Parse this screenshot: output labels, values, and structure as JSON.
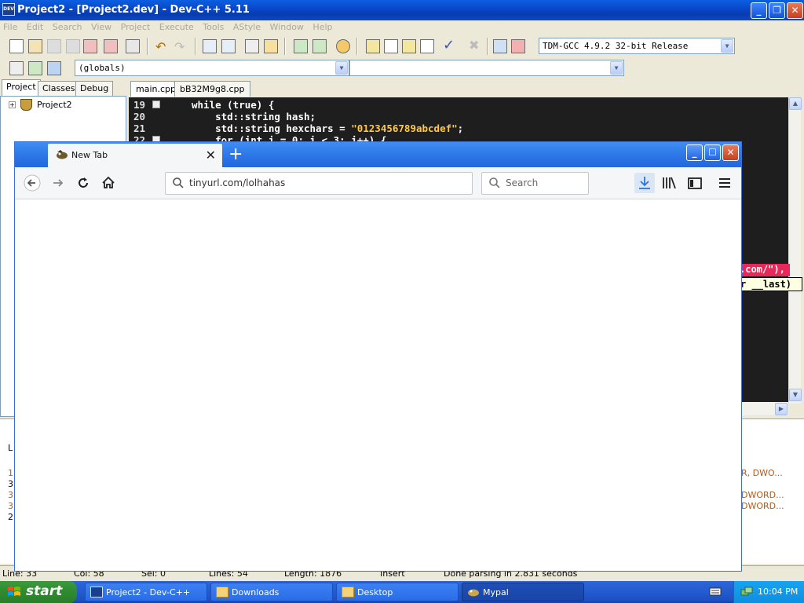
{
  "devcpp": {
    "title": "Project2 - [Project2.dev] - Dev-C++ 5.11",
    "app_icon_text": "DEV",
    "menu": [
      "File",
      "Edit",
      "Search",
      "View",
      "Project",
      "Execute",
      "Tools",
      "AStyle",
      "Window",
      "Help"
    ],
    "compiler": "TDM-GCC 4.9.2 32-bit Release",
    "scope": "(globals)",
    "scope2": "",
    "panel_tabs": [
      "Project",
      "Classes",
      "Debug"
    ],
    "tree_root": "Project2",
    "editor_tabs": [
      "main.cpp",
      "bB32M9g8.cpp"
    ],
    "code_lines": [
      {
        "num": "19",
        "code": "while (true) {"
      },
      {
        "num": "20",
        "code": "    std::string hash;"
      },
      {
        "num": "21",
        "code_pre": "    std::string hexchars = ",
        "string": "\"0123456789abcdef\"",
        "code_post": ";"
      },
      {
        "num": "22",
        "code": "    for (int i = 0; i < 3; i++) {"
      }
    ],
    "hint_red": ".com/\"),",
    "hint_tip": "r __last)",
    "bottom_left": [
      "L",
      "1",
      "3",
      "3",
      "3",
      "2"
    ],
    "bottom_right": [
      "R, DWO...",
      "DWORD...",
      "DWORD..."
    ],
    "status": {
      "line": "Line:    33",
      "col": "Col:    58",
      "sel": "Sel:    0",
      "lines": "Lines:    54",
      "length": "Length:   1876",
      "mode": "Insert",
      "message": "Done parsing in 2.831 seconds"
    }
  },
  "browser": {
    "tab_title": "New Tab",
    "url": "tinyurl.com/lolhahas",
    "search_placeholder": "Search"
  },
  "taskbar": {
    "start": "start",
    "tasks": [
      {
        "label": "Project2 - Dev-C++"
      },
      {
        "label": "Downloads"
      },
      {
        "label": "Desktop"
      },
      {
        "label": "Mypal"
      }
    ],
    "clock": "10:04 PM"
  },
  "colors": {
    "xp_blue": "#0a49c8",
    "start_green": "#2f8a2f",
    "editor_bg": "#1e1e1e",
    "string_yellow": "#ffc847",
    "hint_red": "#e8285a"
  }
}
